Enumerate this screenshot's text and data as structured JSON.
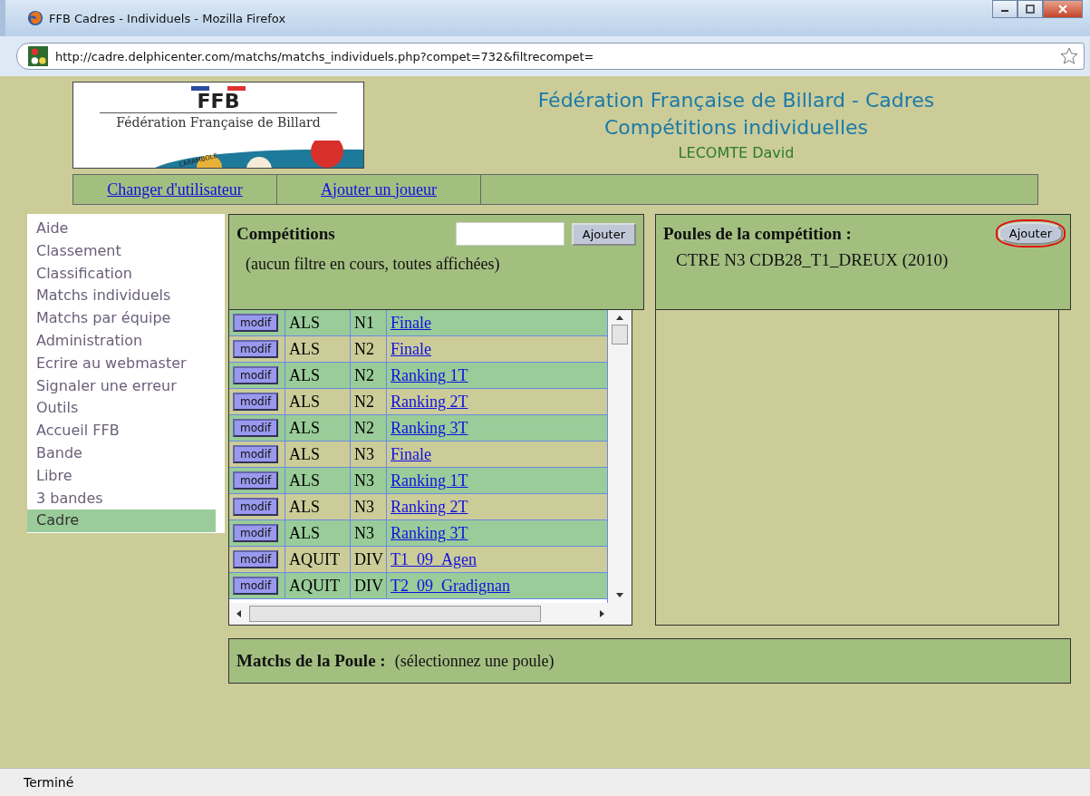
{
  "window": {
    "title": "FFB Cadres - Individuels - Mozilla Firefox"
  },
  "address_bar": {
    "url": "http://cadre.delphicenter.com/matchs/matchs_individuels.php?compet=732&filtrecompet="
  },
  "logo": {
    "initials": "FFB",
    "name": "Fédération Française de Billard",
    "tag": "CARAMBOLE"
  },
  "header": {
    "title": "Fédération Française de Billard - Cadres",
    "subtitle": "Compétitions individuelles",
    "user": "LECOMTE David"
  },
  "nav": [
    {
      "label": "Changer d'utilisateur"
    },
    {
      "label": "Ajouter un joueur"
    }
  ],
  "sidebar": {
    "items": [
      {
        "label": "Aide",
        "selected": false
      },
      {
        "label": "Classement",
        "selected": false
      },
      {
        "label": "Classification",
        "selected": false
      },
      {
        "label": "Matchs individuels",
        "selected": false
      },
      {
        "label": "Matchs par équipe",
        "selected": false
      },
      {
        "label": "Administration",
        "selected": false
      },
      {
        "label": "Ecrire au webmaster",
        "selected": false
      },
      {
        "label": "Signaler une erreur",
        "selected": false
      },
      {
        "label": "Outils",
        "selected": false
      },
      {
        "label": "Accueil FFB",
        "selected": false
      },
      {
        "label": "Bande",
        "selected": false
      },
      {
        "label": "Libre",
        "selected": false
      },
      {
        "label": "3 bandes",
        "selected": false
      },
      {
        "label": "Cadre",
        "selected": true
      }
    ]
  },
  "competitions": {
    "title": "Compétitions",
    "add_button": "Ajouter",
    "filter_note": "(aucun filtre en cours, toutes affichées)",
    "rows": [
      {
        "button": "modif",
        "league": "ALS",
        "level": "N1",
        "name": "Finale"
      },
      {
        "button": "modif",
        "league": "ALS",
        "level": "N2",
        "name": "Finale"
      },
      {
        "button": "modif",
        "league": "ALS",
        "level": "N2",
        "name": "Ranking 1T"
      },
      {
        "button": "modif",
        "league": "ALS",
        "level": "N2",
        "name": "Ranking 2T"
      },
      {
        "button": "modif",
        "league": "ALS",
        "level": "N2",
        "name": "Ranking 3T"
      },
      {
        "button": "modif",
        "league": "ALS",
        "level": "N3",
        "name": "Finale"
      },
      {
        "button": "modif",
        "league": "ALS",
        "level": "N3",
        "name": "Ranking 1T"
      },
      {
        "button": "modif",
        "league": "ALS",
        "level": "N3",
        "name": "Ranking 2T"
      },
      {
        "button": "modif",
        "league": "ALS",
        "level": "N3",
        "name": "Ranking 3T"
      },
      {
        "button": "modif",
        "league": "AQUIT",
        "level": "DIV",
        "name": "T1_09_Agen"
      },
      {
        "button": "modif",
        "league": "AQUIT",
        "level": "DIV",
        "name": "T2_09_Gradignan"
      }
    ]
  },
  "poules": {
    "title": "Poules de la compétition :",
    "add_button": "Ajouter",
    "add_button_highlighted": true,
    "competition": "CTRE N3 CDB28_T1_DREUX (2010)"
  },
  "matchs": {
    "title": "Matchs de la Poule :",
    "note": "(sélectionnez une poule)"
  },
  "status_bar": {
    "text": "Terminé"
  }
}
